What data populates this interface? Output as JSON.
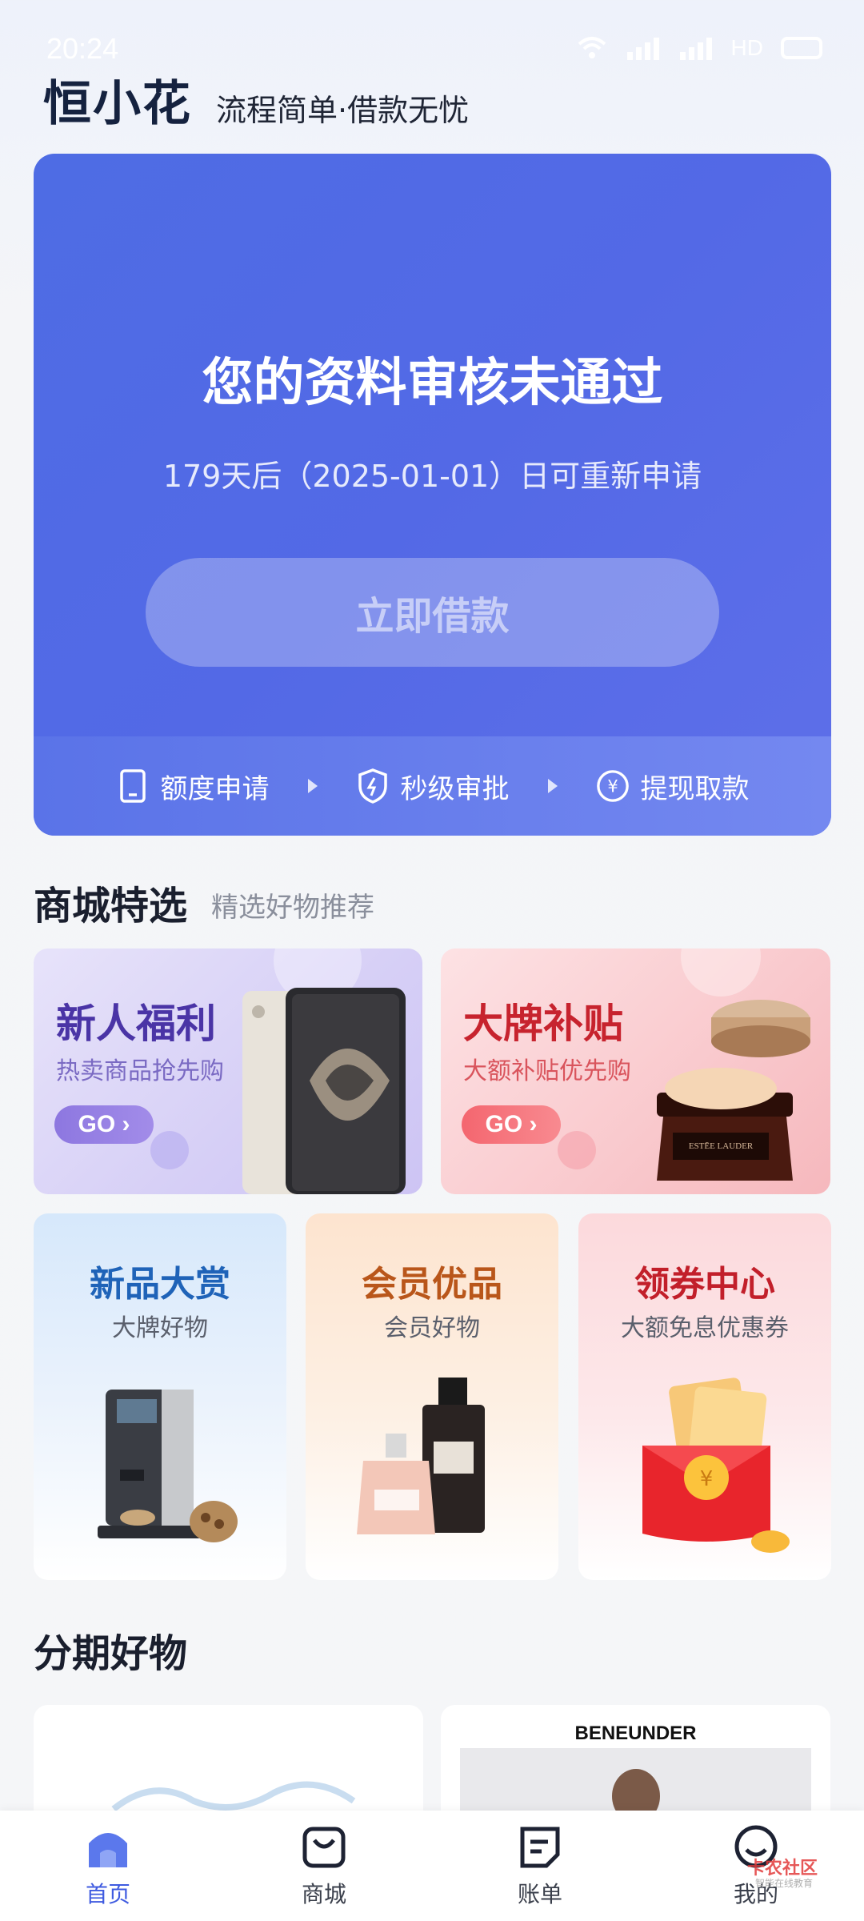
{
  "status": {
    "time": "20:24",
    "network": "HD"
  },
  "brand": {
    "logo": "恒小花",
    "slogan": "流程简单·借款无忧"
  },
  "hero": {
    "title": "您的资料审核未通过",
    "subtitle": "179天后（2025-01-01）日可重新申请",
    "button": "立即借款",
    "steps": [
      "额度申请",
      "秒级审批",
      "提现取款"
    ]
  },
  "mall": {
    "title": "商城特选",
    "subtitle": "精选好物推荐",
    "promos": [
      {
        "title": "新人福利",
        "sub": "热卖商品抢先购",
        "go": "GO"
      },
      {
        "title": "大牌补贴",
        "sub": "大额补贴优先购",
        "go": "GO"
      }
    ],
    "cards": [
      {
        "title": "新品大赏",
        "sub": "大牌好物"
      },
      {
        "title": "会员优品",
        "sub": "会员好物"
      },
      {
        "title": "领券中心",
        "sub": "大额免息优惠券"
      }
    ]
  },
  "installment": {
    "title": "分期好物",
    "brand_right": "BENEUNDER"
  },
  "nav": {
    "items": [
      "首页",
      "商城",
      "账单",
      "我的"
    ]
  },
  "watermark": {
    "text": "卡农社区",
    "sub": "智能在线教育"
  },
  "colors": {
    "primary": "#4e6ce4",
    "purple": "#5b3fb5",
    "red": "#d9303a"
  }
}
